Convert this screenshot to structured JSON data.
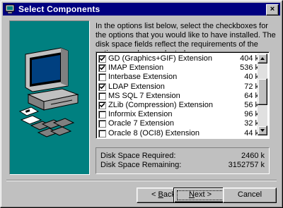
{
  "window": {
    "title": "Select Components",
    "close_label": "×"
  },
  "instructions": "In the options list below, select the checkboxes for the options that you would like to have installed.  The disk space fields reflect the requirements of the options you have selected.",
  "components": [
    {
      "label": "GD (Graphics+GIF) Extension",
      "size": "404 k",
      "checked": true
    },
    {
      "label": "IMAP Extension",
      "size": "536 k",
      "checked": true
    },
    {
      "label": "Interbase Extension",
      "size": "40 k",
      "checked": false
    },
    {
      "label": "LDAP Extension",
      "size": "72 k",
      "checked": true
    },
    {
      "label": "MS SQL 7 Extension",
      "size": "64 k",
      "checked": false
    },
    {
      "label": "ZLib (Compression) Extension",
      "size": "56 k",
      "checked": true
    },
    {
      "label": "Informix Extension",
      "size": "96 k",
      "checked": false
    },
    {
      "label": "Oracle 7 Extension",
      "size": "32 k",
      "checked": false
    },
    {
      "label": "Oracle 8 (OCI8) Extension",
      "size": "44 k",
      "checked": false
    }
  ],
  "disk_space": {
    "required_label": "Disk Space Required:",
    "required_value": "2460 k",
    "remaining_label": "Disk Space Remaining:",
    "remaining_value": "3152757 k"
  },
  "buttons": {
    "back_prefix": "< ",
    "back_mnemonic": "B",
    "back_rest": "ack",
    "next_mnemonic": "N",
    "next_rest": "ext >",
    "cancel": "Cancel"
  },
  "colors": {
    "titlebar": "#000080",
    "art_background": "#008080",
    "face": "#c0c0c0"
  }
}
